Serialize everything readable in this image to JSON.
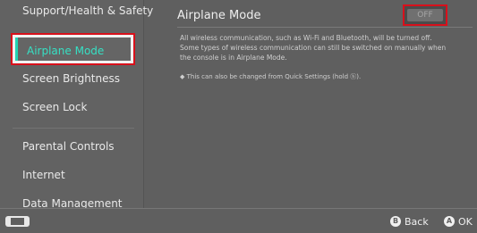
{
  "sidebar": {
    "items": [
      {
        "label": "Support/Health & Safety"
      },
      {
        "label": "Airplane Mode",
        "selected": true
      },
      {
        "label": "Screen Brightness"
      },
      {
        "label": "Screen Lock"
      },
      {
        "label": "Parental Controls"
      },
      {
        "label": "Internet"
      },
      {
        "label": "Data Management"
      }
    ]
  },
  "main": {
    "title": "Airplane Mode",
    "toggle_state": "OFF",
    "description_lines": [
      "All wireless communication, such as Wi-Fi and Bluetooth, will be turned off.",
      "Some types of wireless communication can still be switched on manually when",
      "the console is in Airplane Mode."
    ],
    "hint": "◆ This can also be changed from Quick Settings (hold ⓗ)."
  },
  "footer": {
    "back_glyph": "B",
    "back_label": "Back",
    "ok_glyph": "A",
    "ok_label": "OK"
  },
  "colors": {
    "background": "#5f5f5f",
    "selection_accent": "#22d3b3",
    "highlight_border": "#d8101b"
  },
  "icons": {
    "footer_left": "console-icon"
  }
}
